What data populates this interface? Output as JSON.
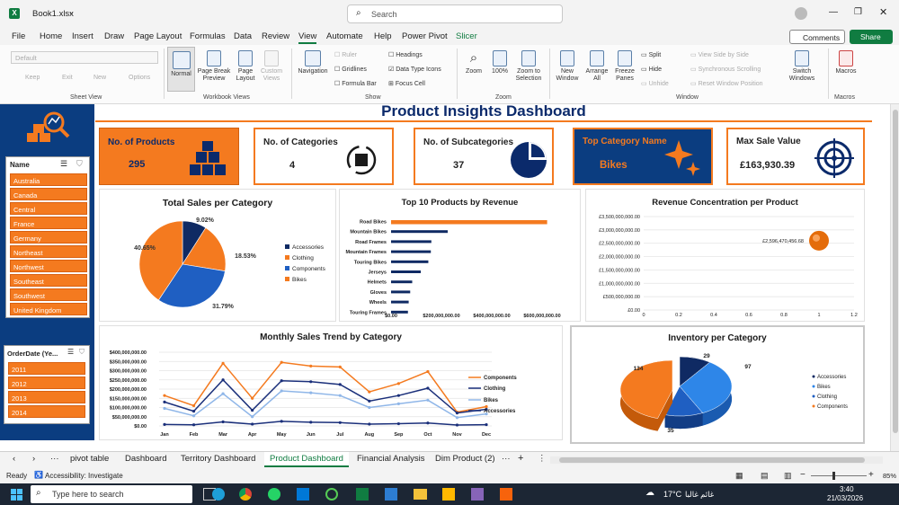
{
  "window": {
    "file_name": "Book1.xlsx",
    "search_placeholder": "Search",
    "comments_label": "Comments",
    "share_label": "Share"
  },
  "menu": [
    "File",
    "Home",
    "Insert",
    "Draw",
    "Page Layout",
    "Formulas",
    "Data",
    "Review",
    "View",
    "Automate",
    "Help",
    "Power Pivot",
    "Slicer"
  ],
  "ribbon": {
    "sheet_view": {
      "dropdown": "Default",
      "keep": "Keep",
      "exit": "Exit",
      "new": "New",
      "options": "Options",
      "label": "Sheet View"
    },
    "workbook_views": {
      "normal": "Normal",
      "page_break_1": "Page Break",
      "page_break_2": "Preview",
      "page_layout_1": "Page",
      "page_layout_2": "Layout",
      "custom_1": "Custom",
      "custom_2": "Views",
      "label": "Workbook Views"
    },
    "show": {
      "navigation": "Navigation",
      "ruler": "Ruler",
      "gridlines": "Gridlines",
      "formula_bar": "Formula Bar",
      "headings": "Headings",
      "data_type_icons": "Data Type Icons",
      "focus_cell": "Focus Cell",
      "label": "Show"
    },
    "zoom": {
      "zoom": "Zoom",
      "hundred": "100%",
      "zoom_sel_1": "Zoom to",
      "zoom_sel_2": "Selection",
      "label": "Zoom"
    },
    "window": {
      "new_1": "New",
      "new_2": "Window",
      "arrange_1": "Arrange",
      "arrange_2": "All",
      "freeze_1": "Freeze",
      "freeze_2": "Panes",
      "split": "Split",
      "hide": "Hide",
      "unhide": "Unhide",
      "side_by_side": "View Side by Side",
      "sync_scroll": "Synchronous Scrolling",
      "reset_pos": "Reset Window Position",
      "switch_1": "Switch",
      "switch_2": "Windows",
      "label": "Window"
    },
    "macros": {
      "macros": "Macros",
      "label": "Macros"
    }
  },
  "dashboard": {
    "title": "Product Insights Dashboard"
  },
  "cards": [
    {
      "label": "No. of Products",
      "value": "295"
    },
    {
      "label": "No. of Categories",
      "value": "4"
    },
    {
      "label": "No. of Subcategories",
      "value": "37"
    },
    {
      "label": "Top Category Name",
      "value": "Bikes"
    },
    {
      "label": "Max Sale Value",
      "value": "£163,930.39"
    }
  ],
  "slicers": {
    "name": {
      "title": "Name",
      "items": [
        "Australia",
        "Canada",
        "Central",
        "France",
        "Germany",
        "Northeast",
        "Northwest",
        "Southeast",
        "Southwest",
        "United Kingdom"
      ]
    },
    "order_date": {
      "title": "OrderDate (Ye...",
      "items": [
        "2011",
        "2012",
        "2013",
        "2014"
      ]
    }
  },
  "chart_data": [
    {
      "type": "pie",
      "title": "Total Sales per Category",
      "labels": [
        "Accessories",
        "Clothing",
        "Components",
        "Bikes"
      ],
      "values": [
        9.02,
        18.53,
        31.79,
        40.65
      ],
      "value_labels": [
        "9.02%",
        "18.53%",
        "31.79%",
        "40.65%"
      ],
      "colors": [
        "#0f2a63",
        "#f47a1f",
        "#1f5fc2",
        "#f47a1f"
      ]
    },
    {
      "type": "bar",
      "title": "Top 10 Products by Revenue",
      "categories": [
        "Road Bikes",
        "Mountain Bikes",
        "Road Frames",
        "Mountain Frames",
        "Touring Bikes",
        "Jerseys",
        "Helmets",
        "Gloves",
        "Wheels",
        "Touring Frames"
      ],
      "values": [
        620000000,
        225000000,
        160000000,
        158000000,
        148000000,
        118000000,
        84000000,
        76000000,
        70000000,
        67000000
      ],
      "xticks": [
        "$0.00",
        "$200,000,000.00",
        "$400,000,000.00",
        "$600,000,000.00"
      ],
      "xlim": [
        0,
        600000000
      ]
    },
    {
      "type": "scatter",
      "title": "Revenue Concentration per Product",
      "points": [
        {
          "x": 1,
          "y": 2596470456.68,
          "label": "£2,596,470,456.68"
        }
      ],
      "yticks": [
        "£0.00",
        "£500,000,000.00",
        "£1,000,000,000.00",
        "£1,500,000,000.00",
        "£2,000,000,000.00",
        "£2,500,000,000.00",
        "£3,000,000,000.00",
        "£3,500,000,000.00"
      ],
      "xticks": [
        "0",
        "0.2",
        "0.4",
        "0.6",
        "0.8",
        "1",
        "1.2"
      ],
      "xlim": [
        0,
        1.2
      ],
      "ylim": [
        0,
        3500000000
      ]
    },
    {
      "type": "line",
      "title": "Monthly Sales Trend by Category",
      "categories": [
        "Jan",
        "Feb",
        "Mar",
        "Apr",
        "May",
        "Jun",
        "Jul",
        "Aug",
        "Sep",
        "Oct",
        "Nov",
        "Dec"
      ],
      "series": [
        {
          "name": "Components",
          "color": "#f47a1f",
          "values": [
            165000000,
            110000000,
            340000000,
            150000000,
            345000000,
            325000000,
            320000000,
            185000000,
            230000000,
            295000000,
            75000000,
            105000000
          ]
        },
        {
          "name": "Clothing",
          "color": "#1a2f7a",
          "values": [
            130000000,
            80000000,
            250000000,
            85000000,
            245000000,
            240000000,
            225000000,
            135000000,
            165000000,
            205000000,
            70000000,
            90000000
          ]
        },
        {
          "name": "Bikes",
          "color": "#8fb6e8",
          "values": [
            95000000,
            55000000,
            175000000,
            50000000,
            190000000,
            180000000,
            165000000,
            100000000,
            120000000,
            140000000,
            45000000,
            65000000
          ]
        },
        {
          "name": "Accessories",
          "color": "#1a2f7a",
          "values": [
            8000000,
            6000000,
            22000000,
            10000000,
            25000000,
            20000000,
            18000000,
            10000000,
            12000000,
            16000000,
            5000000,
            7000000
          ]
        }
      ],
      "yticks": [
        "$0.00",
        "$50,000,000.00",
        "$100,000,000.00",
        "$150,000,000.00",
        "$200,000,000.00",
        "$250,000,000.00",
        "$300,000,000.00",
        "$350,000,000.00",
        "$400,000,000.00"
      ],
      "ylim": [
        0,
        400000000
      ]
    },
    {
      "type": "pie",
      "title": "Inventory per Category",
      "labels": [
        "Accessories",
        "Bikes",
        "Clothing",
        "Components"
      ],
      "values": [
        29,
        97,
        35,
        134
      ],
      "colors": [
        "#0f2a63",
        "#2e86e8",
        "#1f5fc2",
        "#f47a1f"
      ]
    }
  ],
  "tabs": [
    "pivot table",
    "Dashboard",
    "Territory Dashboard",
    "Product Dashboard",
    "Financial Analysis",
    "Dim Product (2)"
  ],
  "status": {
    "ready": "Ready",
    "accessibility": "Accessibility: Investigate",
    "zoom": "85%"
  },
  "taskbar": {
    "search_placeholder": "Type here to search",
    "weather": "17°C",
    "weather_desc": "غائم غالبا",
    "time": "3:40",
    "date": "21/03/2026"
  }
}
